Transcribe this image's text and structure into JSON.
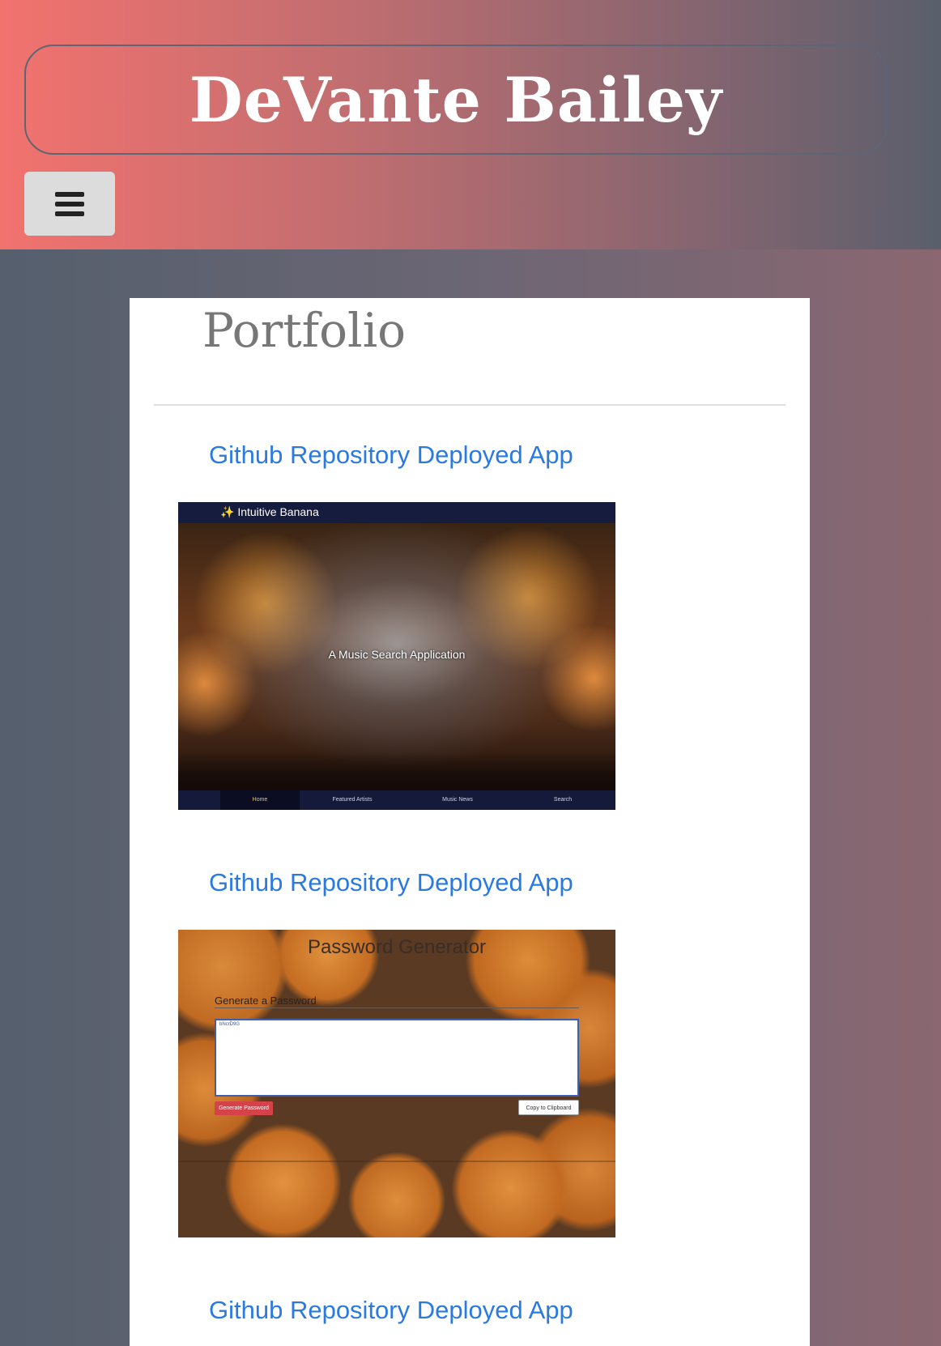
{
  "header": {
    "site_title": "DeVante Bailey",
    "menu_icon": "hamburger-menu-icon"
  },
  "main": {
    "heading": "Portfolio",
    "projects": [
      {
        "repo_label": "Github Repository",
        "app_label": "Deployed App",
        "screenshot": {
          "brand": "Intuitive Banana",
          "tagline": "A Music Search Application",
          "nav": [
            "Home",
            "Featured Artists",
            "Music News",
            "Search"
          ]
        }
      },
      {
        "repo_label": "Github Repository",
        "app_label": "Deployed App",
        "screenshot": {
          "title": "Password Generator",
          "subtitle": "Generate a Password",
          "value": "bNcrD9G",
          "generate_label": "Generate Password",
          "copy_label": "Copy to Clipboard"
        }
      },
      {
        "repo_label": "Github Repository",
        "app_label": "Deployed App"
      }
    ]
  },
  "colors": {
    "link": "#2a7ae2",
    "header_start": "#f2726e",
    "header_end": "#5a5f6c"
  }
}
